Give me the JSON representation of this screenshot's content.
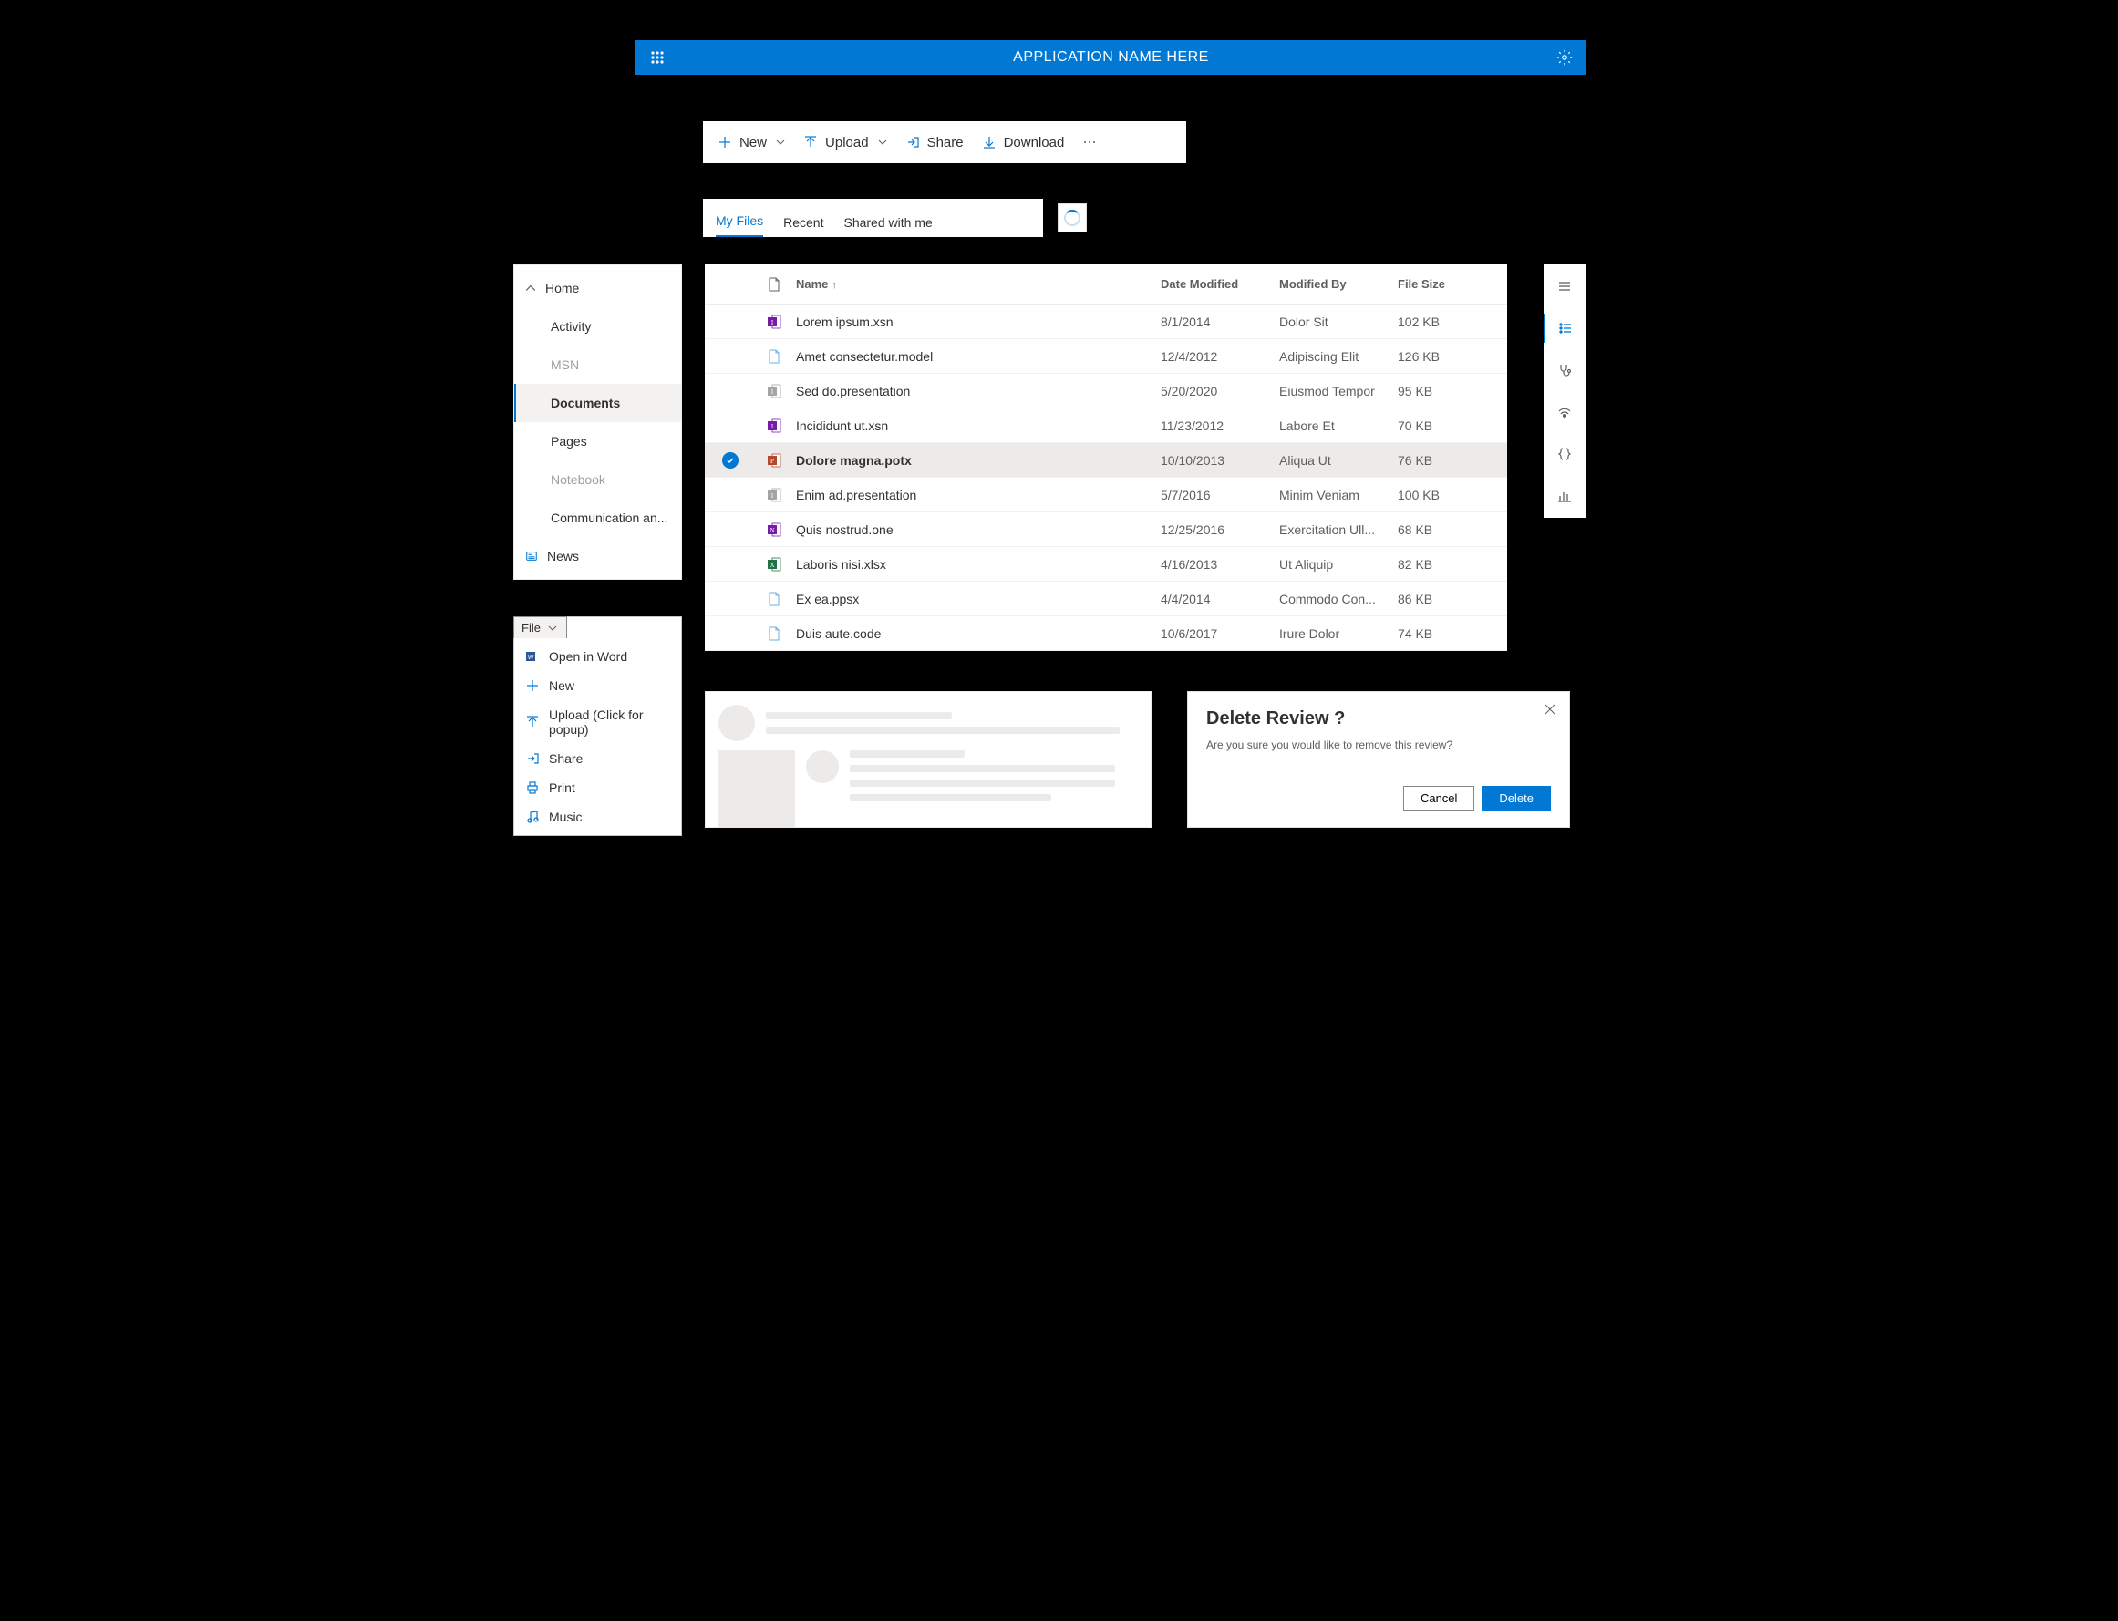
{
  "header": {
    "title": "APPLICATION NAME HERE"
  },
  "commandBar": {
    "new": "New",
    "upload": "Upload",
    "share": "Share",
    "download": "Download"
  },
  "tabs": {
    "items": [
      "My Files",
      "Recent",
      "Shared with me"
    ],
    "activeIndex": 0
  },
  "leftNav": {
    "home": "Home",
    "items": [
      {
        "label": "Activity",
        "muted": false
      },
      {
        "label": "MSN",
        "muted": true
      },
      {
        "label": "Documents",
        "muted": false,
        "selected": true
      },
      {
        "label": "Pages",
        "muted": false
      },
      {
        "label": "Notebook",
        "muted": true
      },
      {
        "label": "Communication an...",
        "muted": false
      }
    ],
    "news": "News"
  },
  "fileTable": {
    "columns": {
      "name": "Name",
      "date": "Date Modified",
      "modby": "Modified By",
      "size": "File Size"
    },
    "rows": [
      {
        "icon": "infopath",
        "name": "Lorem ipsum.xsn",
        "date": "8/1/2014",
        "modby": "Dolor Sit",
        "size": "102 KB",
        "selected": false
      },
      {
        "icon": "generic",
        "name": "Amet consectetur.model",
        "date": "12/4/2012",
        "modby": "Adipiscing Elit",
        "size": "126 KB",
        "selected": false
      },
      {
        "icon": "sway",
        "name": "Sed do.presentation",
        "date": "5/20/2020",
        "modby": "Eiusmod Tempor",
        "size": "95 KB",
        "selected": false
      },
      {
        "icon": "infopath",
        "name": "Incididunt ut.xsn",
        "date": "11/23/2012",
        "modby": "Labore Et",
        "size": "70 KB",
        "selected": false
      },
      {
        "icon": "powerpoint",
        "name": "Dolore magna.potx",
        "date": "10/10/2013",
        "modby": "Aliqua Ut",
        "size": "76 KB",
        "selected": true
      },
      {
        "icon": "sway",
        "name": "Enim ad.presentation",
        "date": "5/7/2016",
        "modby": "Minim Veniam",
        "size": "100 KB",
        "selected": false
      },
      {
        "icon": "onenote",
        "name": "Quis nostrud.one",
        "date": "12/25/2016",
        "modby": "Exercitation Ull...",
        "size": "68 KB",
        "selected": false
      },
      {
        "icon": "excel",
        "name": "Laboris nisi.xlsx",
        "date": "4/16/2013",
        "modby": "Ut Aliquip",
        "size": "82 KB",
        "selected": false
      },
      {
        "icon": "generic",
        "name": "Ex ea.ppsx",
        "date": "4/4/2014",
        "modby": "Commodo Con...",
        "size": "86 KB",
        "selected": false
      },
      {
        "icon": "generic",
        "name": "Duis aute.code",
        "date": "10/6/2017",
        "modby": "Irure Dolor",
        "size": "74 KB",
        "selected": false
      }
    ]
  },
  "rightRail": {
    "buttons": [
      "menu",
      "list",
      "stethoscope",
      "broadcast",
      "braces",
      "chart"
    ],
    "activeIndex": 1
  },
  "fileMenu": {
    "trigger": "File",
    "items": [
      {
        "icon": "word",
        "label": "Open in Word"
      },
      {
        "icon": "plus",
        "label": "New"
      },
      {
        "icon": "upload",
        "label": "Upload (Click for popup)"
      },
      {
        "icon": "share",
        "label": "Share"
      },
      {
        "icon": "print",
        "label": "Print"
      },
      {
        "icon": "music",
        "label": "Music"
      }
    ]
  },
  "dialog": {
    "title": "Delete Review ?",
    "body": "Are you sure you would like to remove this review?",
    "cancel": "Cancel",
    "confirm": "Delete"
  },
  "iconColors": {
    "infopath": "#7719aa",
    "generic": "#69afe5",
    "sway": "#a4a4a4",
    "powerpoint": "#b7472a",
    "onenote": "#7719aa",
    "excel": "#217346",
    "word": "#2b579a"
  }
}
